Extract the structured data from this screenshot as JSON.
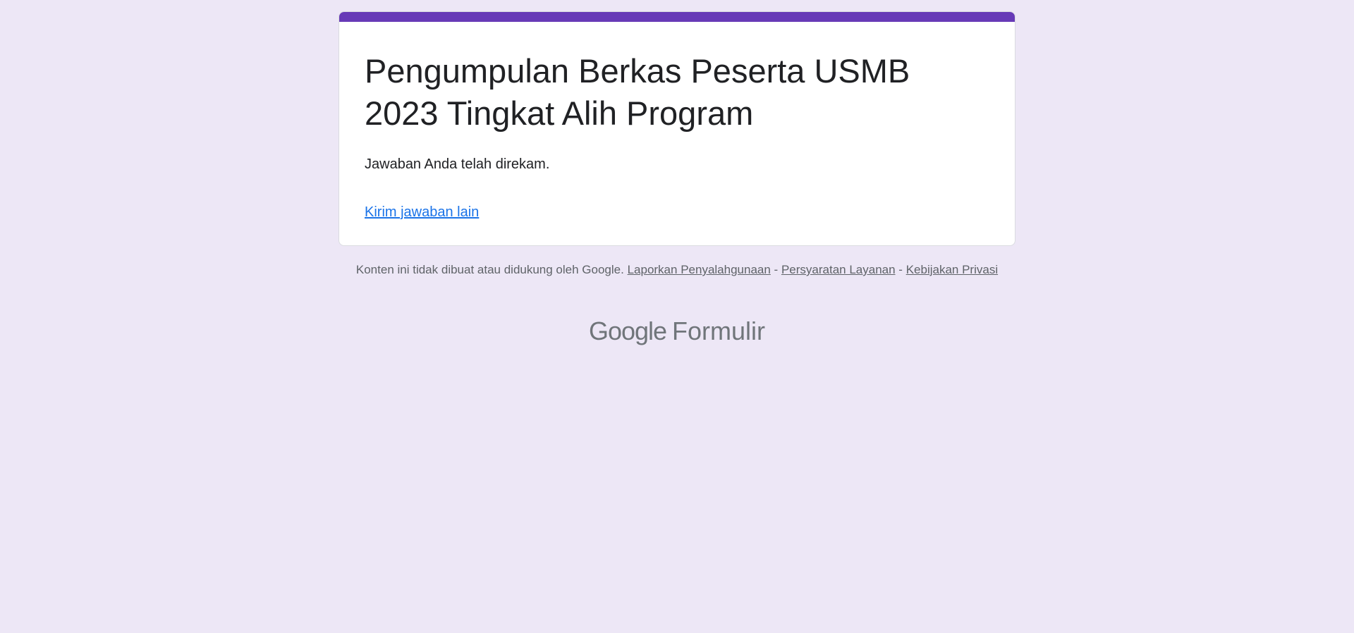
{
  "theme": {
    "accent_color": "#673ab7",
    "background_color": "#ede7f6",
    "link_color": "#1a73e8"
  },
  "form": {
    "title": "Pengumpulan Berkas Peserta USMB 2023 Tingkat Alih Program",
    "confirmation_message": "Jawaban Anda telah direkam.",
    "submit_another_link": "Kirim jawaban lain"
  },
  "footer": {
    "disclaimer": "Konten ini tidak dibuat atau didukung oleh Google.",
    "report_abuse_link": "Laporkan Penyalahgunaan",
    "separator_1": "-",
    "terms_link": "Persyaratan Layanan",
    "separator_2": "-",
    "privacy_link": "Kebijakan Privasi"
  },
  "brand": {
    "google": "Google",
    "product": "Formulir"
  }
}
